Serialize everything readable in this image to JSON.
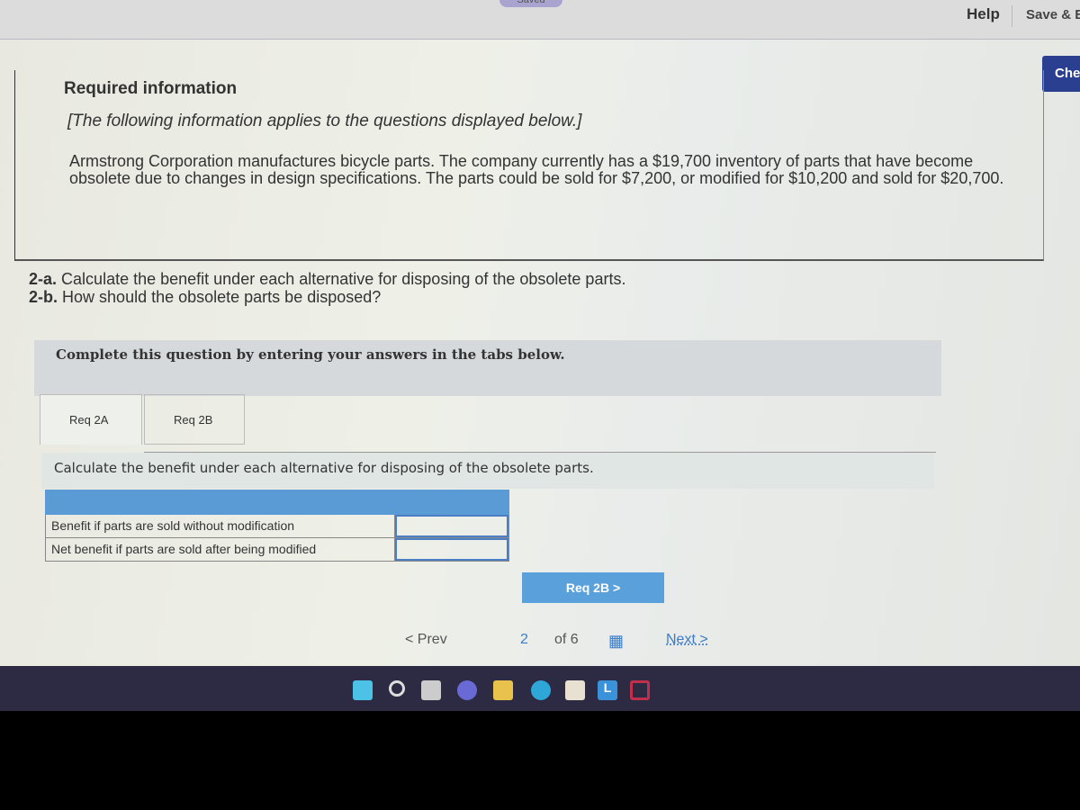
{
  "header": {
    "saved": "Saved",
    "help": "Help",
    "save_exit": "Save & E",
    "check": "Che"
  },
  "info": {
    "title": "Required information",
    "applies": "[The following information applies to the questions displayed below.]",
    "text": "Armstrong Corporation manufactures bicycle parts. The company currently has a $19,700 inventory of parts that have become obsolete due to changes in design specifications. The parts could be sold for $7,200, or modified for $10,200 and sold for $20,700."
  },
  "questions": [
    {
      "num": "2-a.",
      "text": "Calculate the benefit under each alternative for disposing of the obsolete parts."
    },
    {
      "num": "2-b.",
      "text": "How should the obsolete parts be disposed?"
    }
  ],
  "complete": "Complete this question by entering your answers in the tabs below.",
  "tabs": [
    {
      "label": "Req 2A",
      "active": true
    },
    {
      "label": "Req 2B",
      "active": false
    }
  ],
  "instruction": "Calculate the benefit under each alternative for disposing of the obsolete parts.",
  "table": {
    "rows": [
      {
        "label": "Benefit if parts are sold without modification",
        "value": ""
      },
      {
        "label": "Net benefit if parts are sold after being modified",
        "value": ""
      }
    ]
  },
  "next_req": "Req 2B  >",
  "pager": {
    "prev": "< Prev",
    "current": "2",
    "of": "of 6",
    "next": "Next >"
  },
  "colors": {
    "accent": "#5aa0db",
    "header_blue": "#5b9bd5",
    "check": "#2a3f8f"
  }
}
